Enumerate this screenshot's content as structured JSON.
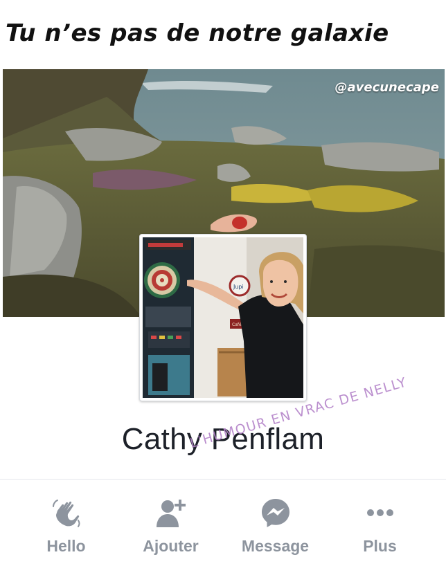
{
  "caption": "Tu n’es pas de notre galaxie",
  "cover": {
    "watermark_handle": "@avecunecape"
  },
  "profile": {
    "name": "Cathy Penflam",
    "photo_sign_text": "Jupi",
    "photo_sign2_text": "Café - Bar"
  },
  "watermark_text": "L'HUMOUR EN VRAC DE NELLY",
  "actions": [
    {
      "label": "Hello",
      "icon": "wave-hand-icon"
    },
    {
      "label": "Ajouter",
      "icon": "add-friend-icon"
    },
    {
      "label": "Message",
      "icon": "messenger-icon"
    },
    {
      "label": "Plus",
      "icon": "more-dots-icon"
    }
  ],
  "colors": {
    "action_gray": "#8d949e",
    "name_text": "#1d2129",
    "watermark_purple": "#b483c9"
  }
}
